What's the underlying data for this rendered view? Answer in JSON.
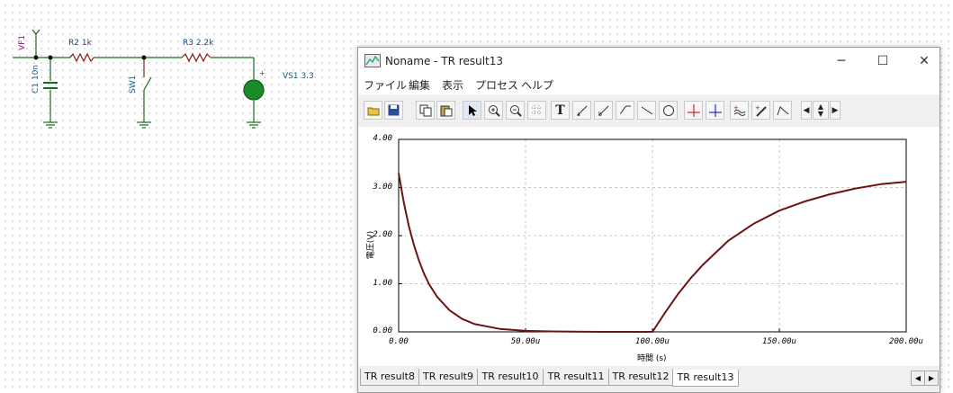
{
  "schematic": {
    "vf1": "VF1",
    "r2": "R2 1k",
    "r3": "R3 2.2k",
    "c1": "C1 10n",
    "sw1": "SW1",
    "vs1": "VS1 3.3",
    "plus": "+"
  },
  "window": {
    "title": "Noname - TR result13",
    "minimize": "─",
    "maximize": "☐",
    "close": "✕"
  },
  "menu": [
    "ファイル",
    "編集",
    "表示",
    "プロセス",
    "ヘルプ"
  ],
  "toolbar": [
    "open-icon",
    "save-icon",
    "copy-icon",
    "paste-icon",
    "pointer-icon",
    "zoom-in-icon",
    "zoom-out-icon",
    "grid-icon",
    "text-icon",
    "arrow-text-icon",
    "arrow-text2-icon",
    "arrow-text3-icon",
    "line-icon",
    "circle-icon",
    "cursor-a-icon",
    "cursor-b-icon",
    "add-wave-icon",
    "add-probe-icon",
    "corner-icon",
    "prev-icon",
    "updown-icon",
    "next-icon"
  ],
  "tabs": [
    "TR result8",
    "TR result9",
    "TR result10",
    "TR result11",
    "TR result12",
    "TR result13"
  ],
  "chart_data": {
    "type": "line",
    "xlabel": "時間 (s)",
    "ylabel": "電圧(V)",
    "x_ticks": [
      "0.00",
      "50.00u",
      "100.00u",
      "150.00u",
      "200.00u"
    ],
    "y_ticks": [
      "4.00",
      "3.00",
      "2.00",
      "1.00",
      "0.00"
    ],
    "xlim": [
      0,
      200
    ],
    "ylim": [
      0,
      4
    ],
    "grid": true,
    "series": [
      {
        "color": "#6b1414",
        "x": [
          0,
          2,
          4,
          6,
          8,
          10,
          12,
          15,
          20,
          25,
          30,
          40,
          50,
          60,
          80,
          99,
          100,
          105,
          110,
          115,
          120,
          130,
          140,
          150,
          160,
          170,
          180,
          190,
          200
        ],
        "y": [
          3.3,
          2.7,
          2.2,
          1.81,
          1.48,
          1.21,
          0.99,
          0.74,
          0.45,
          0.27,
          0.16,
          0.06,
          0.02,
          0.01,
          0.0,
          0.0,
          0.0,
          0.4,
          0.78,
          1.11,
          1.4,
          1.9,
          2.25,
          2.52,
          2.71,
          2.86,
          2.98,
          3.07,
          3.12
        ]
      }
    ]
  }
}
